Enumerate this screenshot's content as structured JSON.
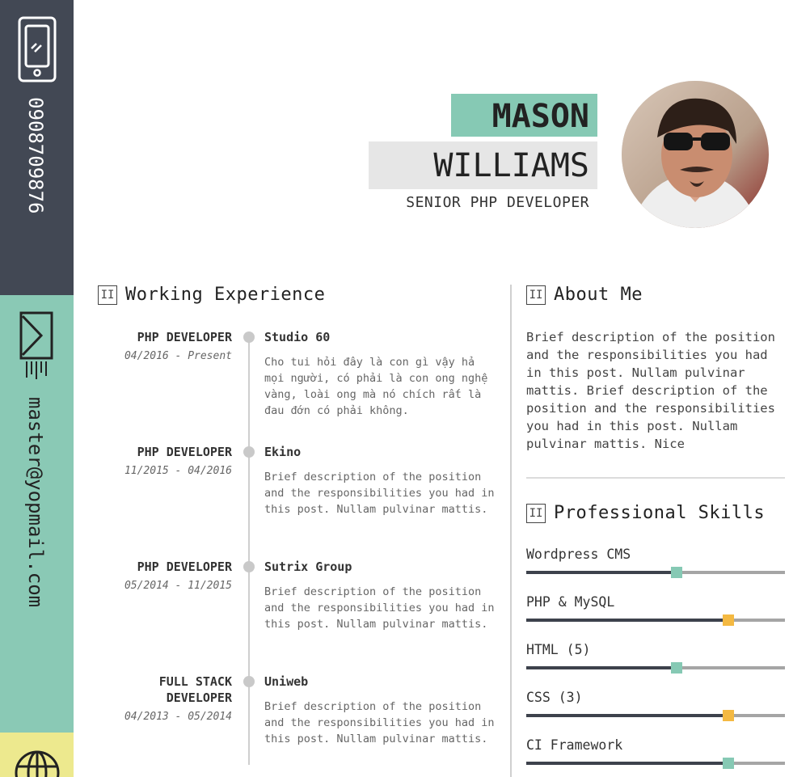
{
  "contact": {
    "phone": "0908709876",
    "email": "master@yopmail.com"
  },
  "header": {
    "first_name": "MASON",
    "last_name": "WILLIAMS",
    "title": "SENIOR PHP DEVELOPER"
  },
  "sections": {
    "experience_mark": "II",
    "experience_title": "Working Experience",
    "about_mark": "II",
    "about_title": "About Me",
    "skills_mark": "II",
    "skills_title": "Professional Skills"
  },
  "experience": [
    {
      "role": "PHP DEVELOPER",
      "date": "04/2016 - Present",
      "company": "Studio 60",
      "description": "Cho tui hỏi đây là con gì vậy hả mọi người, có phải là con ong nghệ vàng, loài ong mà nó chích rất là đau đớn có phải không."
    },
    {
      "role": "PHP DEVELOPER",
      "date": "11/2015 - 04/2016",
      "company": "Ekino",
      "description": "Brief description of the position and the responsibilities you had in this post. Nullam pulvinar mattis."
    },
    {
      "role": "PHP DEVELOPER",
      "date": "05/2014 - 11/2015",
      "company": "Sutrix Group",
      "description": "Brief description of the position and the responsibilities you had in this post. Nullam pulvinar mattis."
    },
    {
      "role": "FULL STACK DEVELOPER",
      "date": "04/2013 - 05/2014",
      "company": "Uniweb",
      "description": "Brief description of the position and the responsibilities you had in this post. Nullam pulvinar mattis."
    }
  ],
  "about": {
    "text": "Brief description of the position and the responsibilities you had in this post. Nullam pulvinar mattis. Brief description of the position and the responsibilities you had in this post. Nullam pulvinar mattis. Nice"
  },
  "skills": [
    {
      "name": "Wordpress CMS",
      "level": 0.58,
      "color": "#86c9b4"
    },
    {
      "name": "PHP & MySQL",
      "level": 0.78,
      "color": "#f4b942"
    },
    {
      "name": "HTML (5)",
      "level": 0.58,
      "color": "#86c9b4"
    },
    {
      "name": "CSS (3)",
      "level": 0.78,
      "color": "#f4b942"
    },
    {
      "name": "CI Framework",
      "level": 0.78,
      "color": "#86c9b4"
    }
  ],
  "colors": {
    "sidebar_dark": "#424854",
    "accent_green": "#86c9b4",
    "accent_yellow": "#ede98e"
  }
}
